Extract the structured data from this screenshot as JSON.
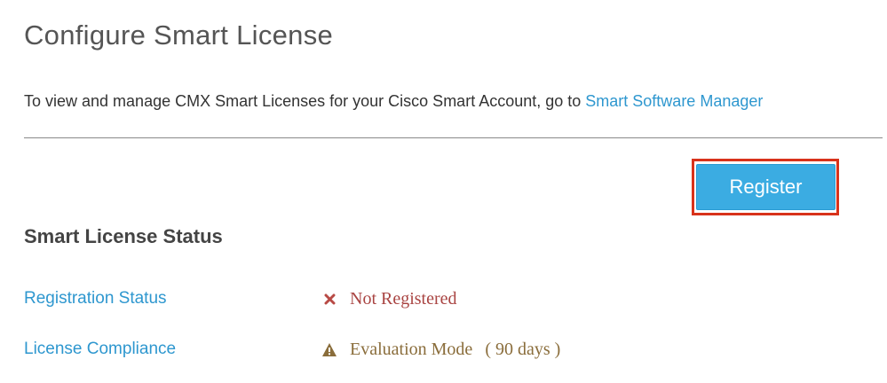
{
  "header": {
    "title": "Configure Smart License"
  },
  "intro": {
    "text": "To view and manage CMX Smart Licenses for your Cisco Smart Account, go to ",
    "link_label": "Smart Software Manager"
  },
  "actions": {
    "register_label": "Register"
  },
  "status_section": {
    "title": "Smart License Status",
    "rows": [
      {
        "label": "Registration Status",
        "value": "Not Registered",
        "icon": "x-icon",
        "color": "#a94442"
      },
      {
        "label": "License Compliance",
        "value": "Evaluation Mode",
        "detail": "( 90 days )",
        "icon": "warning-triangle-icon",
        "color": "#8a6d3b"
      }
    ]
  },
  "colors": {
    "accent": "#2e97cf",
    "button": "#3bace2",
    "highlight": "#d8321b"
  }
}
